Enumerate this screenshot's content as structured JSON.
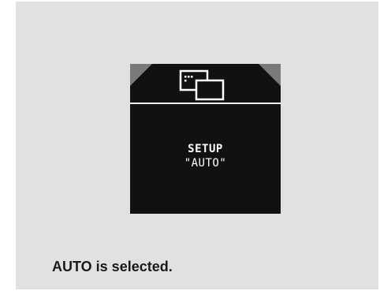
{
  "display": {
    "icon": "window-overlap-icon",
    "title": "SETUP",
    "value": "\"AUTO\"",
    "background_color": "#111111",
    "text_color": "#ffffff",
    "corner_color": "#7a7a7a"
  },
  "caption": {
    "text": "AUTO is selected."
  },
  "panel": {
    "background_color": "#e1e1e1"
  }
}
